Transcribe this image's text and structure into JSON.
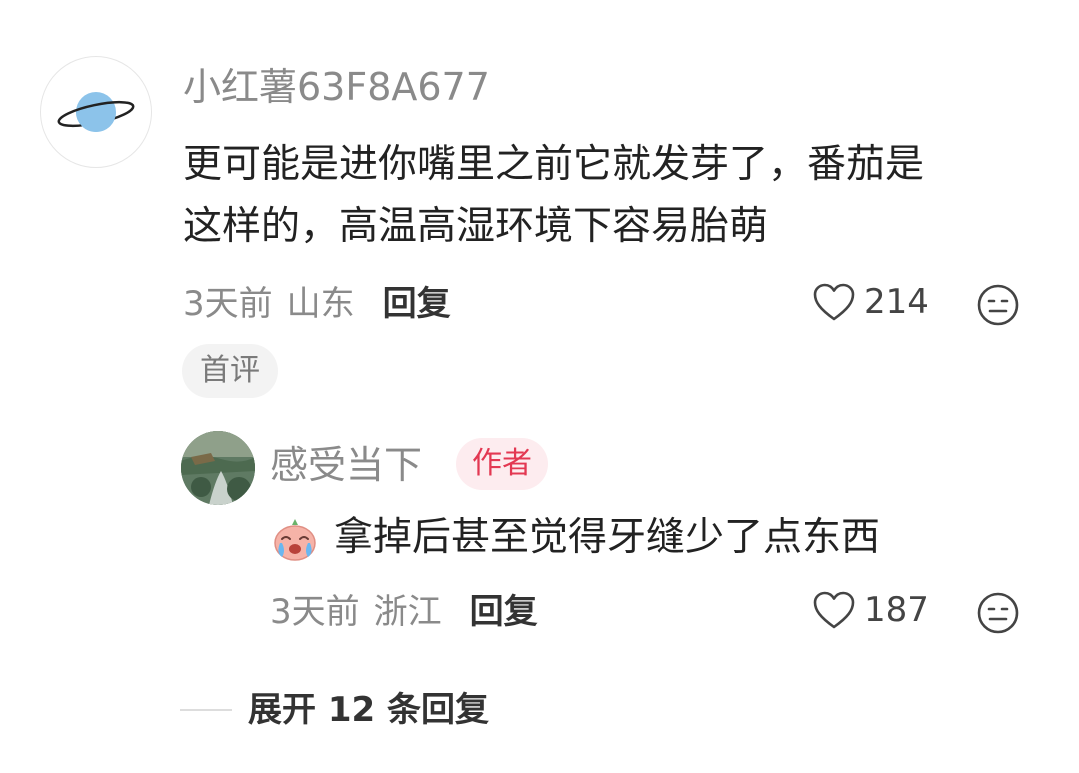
{
  "comment": {
    "username": "小红薯63F8A677",
    "text_line1": "更可能是进你嘴里之前它就发芽了，番茄是",
    "text_line2": "这样的，高温高湿环境下容易胎萌",
    "time": "3天前",
    "location": "山东",
    "reply_label": "回复",
    "likes": "214",
    "badge": "首评"
  },
  "reply": {
    "username": "感受当下",
    "author_badge": "作者",
    "text": "拿掉后甚至觉得牙缝少了点东西",
    "time": "3天前",
    "location": "浙江",
    "reply_label": "回复",
    "likes": "187"
  },
  "expand": {
    "label": "展开 12 条回复"
  },
  "icons": {
    "avatar_main": "planet-icon",
    "like": "heart-outline-icon",
    "emoji": "emoji-face-icon",
    "sticker": "crying-face-sticker"
  },
  "colors": {
    "author_badge_text": "#e33852",
    "author_badge_bg": "#fdecef",
    "planet_blue": "#8cc3ea"
  }
}
